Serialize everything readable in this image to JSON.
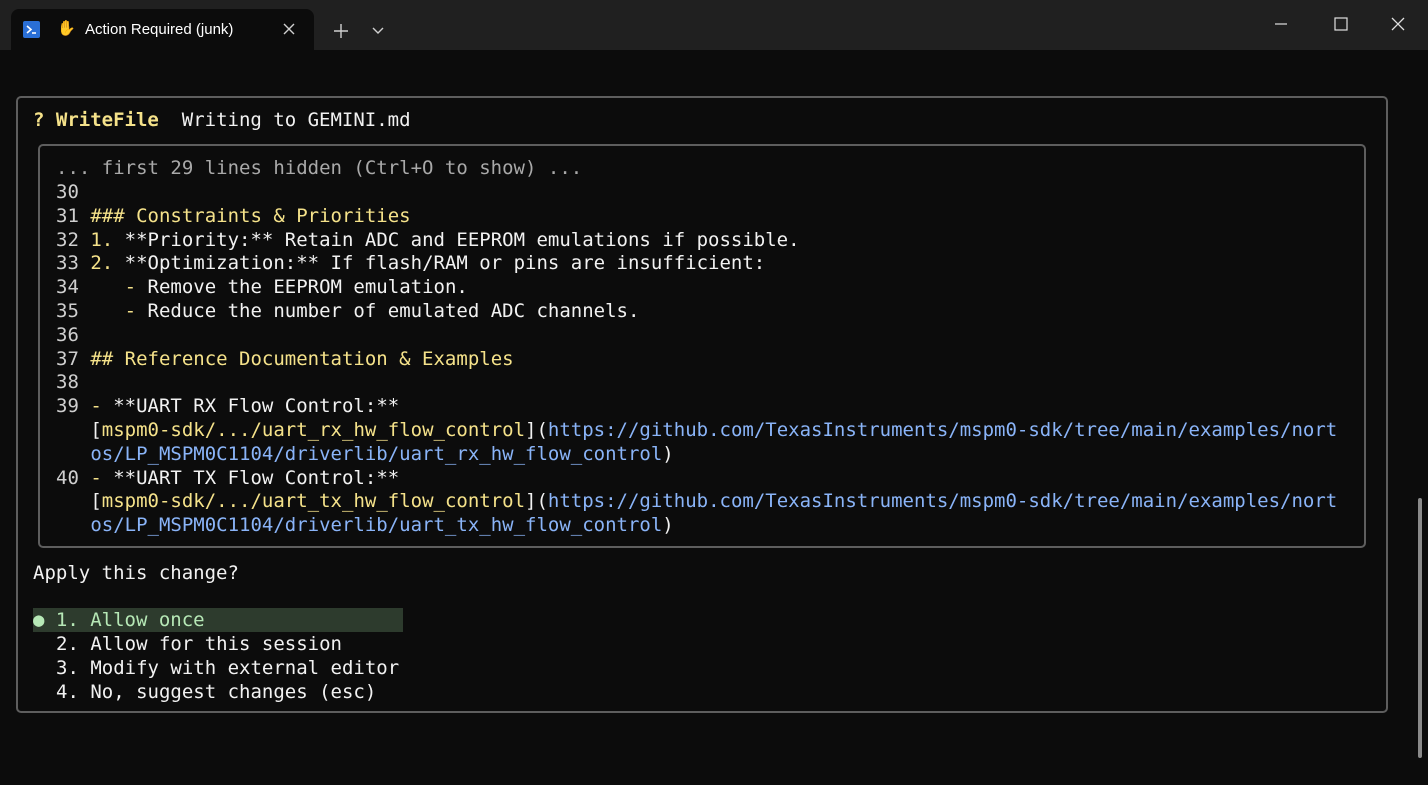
{
  "tab": {
    "title": "Action Required (junk)",
    "icons": {
      "shell": "powershell-icon",
      "status": "raised-hand-icon"
    }
  },
  "titlebar": {
    "new_tab": "+",
    "dropdown": "chevron-down-icon"
  },
  "dialog": {
    "marker": "?",
    "tool": "WriteFile",
    "description": "Writing to GEMINI.md",
    "hidden_notice": "... first 29 lines hidden (Ctrl+O to show) ...",
    "lines": [
      {
        "n": "30",
        "segments": []
      },
      {
        "n": "31",
        "segments": [
          {
            "t": "### Constraints & Priorities",
            "c": "yel"
          }
        ]
      },
      {
        "n": "32",
        "segments": [
          {
            "t": "1. ",
            "c": "yel"
          },
          {
            "t": "**Priority:** Retain ADC and EEPROM emulations if possible.",
            "c": "wht"
          }
        ]
      },
      {
        "n": "33",
        "segments": [
          {
            "t": "2. ",
            "c": "yel"
          },
          {
            "t": "**Optimization:** If flash/RAM or pins are insufficient:",
            "c": "wht"
          }
        ]
      },
      {
        "n": "34",
        "segments": [
          {
            "t": "   - ",
            "c": "yel"
          },
          {
            "t": "Remove the EEPROM emulation.",
            "c": "wht"
          }
        ]
      },
      {
        "n": "35",
        "segments": [
          {
            "t": "   - ",
            "c": "yel"
          },
          {
            "t": "Reduce the number of emulated ADC channels.",
            "c": "wht"
          }
        ]
      },
      {
        "n": "36",
        "segments": []
      },
      {
        "n": "37",
        "segments": [
          {
            "t": "## Reference Documentation & Examples",
            "c": "yel"
          }
        ]
      },
      {
        "n": "38",
        "segments": []
      },
      {
        "n": "39",
        "segments": [
          {
            "t": "- ",
            "c": "yel"
          },
          {
            "t": "**UART RX Flow Control:**",
            "c": "wht"
          }
        ]
      },
      {
        "n": "",
        "segments": [
          {
            "t": "[",
            "c": "wht"
          },
          {
            "t": "mspm0-sdk/.../uart_rx_hw_flow_control",
            "c": "yel"
          },
          {
            "t": "](",
            "c": "wht"
          },
          {
            "t": "https://github.com/TexasInstruments/mspm0-sdk/tree/main/examples/nort",
            "c": "link"
          }
        ]
      },
      {
        "n": "",
        "segments": [
          {
            "t": "os/LP_MSPM0C1104/driverlib/uart_rx_hw_flow_control",
            "c": "link"
          },
          {
            "t": ")",
            "c": "wht"
          }
        ]
      },
      {
        "n": "40",
        "segments": [
          {
            "t": "- ",
            "c": "yel"
          },
          {
            "t": "**UART TX Flow Control:**",
            "c": "wht"
          }
        ]
      },
      {
        "n": "",
        "segments": [
          {
            "t": "[",
            "c": "wht"
          },
          {
            "t": "mspm0-sdk/.../uart_tx_hw_flow_control",
            "c": "yel"
          },
          {
            "t": "](",
            "c": "wht"
          },
          {
            "t": "https://github.com/TexasInstruments/mspm0-sdk/tree/main/examples/nort",
            "c": "link"
          }
        ]
      },
      {
        "n": "",
        "segments": [
          {
            "t": "os/LP_MSPM0C1104/driverlib/uart_tx_hw_flow_control",
            "c": "link"
          },
          {
            "t": ")",
            "c": "wht"
          }
        ]
      }
    ],
    "prompt": "Apply this change?",
    "options": {
      "bullet": "●",
      "o1": "1. Allow once",
      "o2": "2. Allow for this session",
      "o3": "3. Modify with external editor",
      "o4": "4. No, suggest changes (esc)"
    }
  },
  "colors": {
    "background": "#0c0c0c",
    "titlebar": "#202020",
    "accent_yellow": "#f5e28a",
    "link_blue": "#8ab4f8",
    "selected_green": "#b6e8b6"
  }
}
